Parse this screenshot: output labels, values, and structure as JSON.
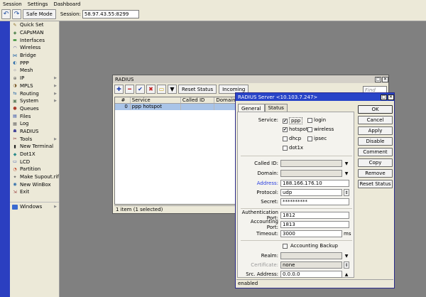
{
  "menu": [
    "Session",
    "Settings",
    "Dashboard"
  ],
  "toolbar": {
    "undo_icon": "undo-icon",
    "redo_icon": "redo-icon",
    "safe_mode": "Safe Mode",
    "session_label": "Session:",
    "session_value": "58.97.43.55:8299"
  },
  "sidebar": [
    {
      "label": "Quick Set",
      "icon": "wand-icon",
      "sub": false
    },
    {
      "label": "CAPsMAN",
      "icon": "capsman-icon",
      "sub": false
    },
    {
      "label": "Interfaces",
      "icon": "interfaces-icon",
      "sub": false
    },
    {
      "label": "Wireless",
      "icon": "wireless-icon",
      "sub": false
    },
    {
      "label": "Bridge",
      "icon": "bridge-icon",
      "sub": false
    },
    {
      "label": "PPP",
      "icon": "ppp-icon",
      "sub": false
    },
    {
      "label": "Mesh",
      "icon": "mesh-icon",
      "sub": false
    },
    {
      "label": "IP",
      "icon": "ip-icon",
      "sub": true
    },
    {
      "label": "MPLS",
      "icon": "mpls-icon",
      "sub": true
    },
    {
      "label": "Routing",
      "icon": "routing-icon",
      "sub": true
    },
    {
      "label": "System",
      "icon": "system-icon",
      "sub": true
    },
    {
      "label": "Queues",
      "icon": "queues-icon",
      "sub": false
    },
    {
      "label": "Files",
      "icon": "files-icon",
      "sub": false
    },
    {
      "label": "Log",
      "icon": "log-icon",
      "sub": false
    },
    {
      "label": "RADIUS",
      "icon": "radius-icon",
      "sub": false
    },
    {
      "label": "Tools",
      "icon": "tools-icon",
      "sub": true
    },
    {
      "label": "New Terminal",
      "icon": "terminal-icon",
      "sub": false
    },
    {
      "label": "Dot1X",
      "icon": "dot1x-icon",
      "sub": false
    },
    {
      "label": "LCD",
      "icon": "lcd-icon",
      "sub": false
    },
    {
      "label": "Partition",
      "icon": "partition-icon",
      "sub": false
    },
    {
      "label": "Make Supout.rif",
      "icon": "supout-icon",
      "sub": false
    },
    {
      "label": "New WinBox",
      "icon": "winbox-icon",
      "sub": false
    },
    {
      "label": "Exit",
      "icon": "exit-icon",
      "sub": false
    }
  ],
  "sidebar_windows": "Windows",
  "radius": {
    "title": "RADIUS",
    "reset_status": "Reset Status",
    "incoming": "Incoming",
    "find_placeholder": "Find",
    "columns": [
      "#",
      "Service",
      "Called ID",
      "Domain"
    ],
    "rows": [
      {
        "num": "0",
        "service": "ppp hotspot",
        "called_id": "",
        "domain": ""
      }
    ],
    "status": "1 item (1 selected)"
  },
  "server": {
    "title": "RADIUS Server <10.103.7.247>",
    "tabs": [
      "General",
      "Status"
    ],
    "service_label": "Service:",
    "services": [
      {
        "label": "ppp",
        "checked": true
      },
      {
        "label": "login",
        "checked": false
      },
      {
        "label": "hotspot",
        "checked": true
      },
      {
        "label": "wireless",
        "checked": false
      },
      {
        "label": "dhcp",
        "checked": false
      },
      {
        "label": "ipsec",
        "checked": false
      },
      {
        "label": "dot1x",
        "checked": false
      }
    ],
    "called_id_label": "Called ID:",
    "domain_label": "Domain:",
    "address_label": "Address:",
    "address": "188.166.176.10",
    "protocol_label": "Protocol:",
    "protocol": "udp",
    "secret_label": "Secret:",
    "secret": "**********",
    "auth_port_label": "Authentication Port:",
    "auth_port": "1812",
    "acct_port_label": "Accounting Port:",
    "acct_port": "1813",
    "timeout_label": "Timeout:",
    "timeout": "3000",
    "timeout_unit": "ms",
    "acct_backup_label": "Accounting Backup",
    "realm_label": "Realm:",
    "certificate_label": "Certificate:",
    "certificate": "none",
    "src_address_label": "Src. Address:",
    "src_address": "0.0.0.0",
    "buttons": [
      "OK",
      "Cancel",
      "Apply",
      "Disable",
      "Comment",
      "Copy",
      "Remove",
      "Reset Status"
    ],
    "status": "enabled"
  }
}
